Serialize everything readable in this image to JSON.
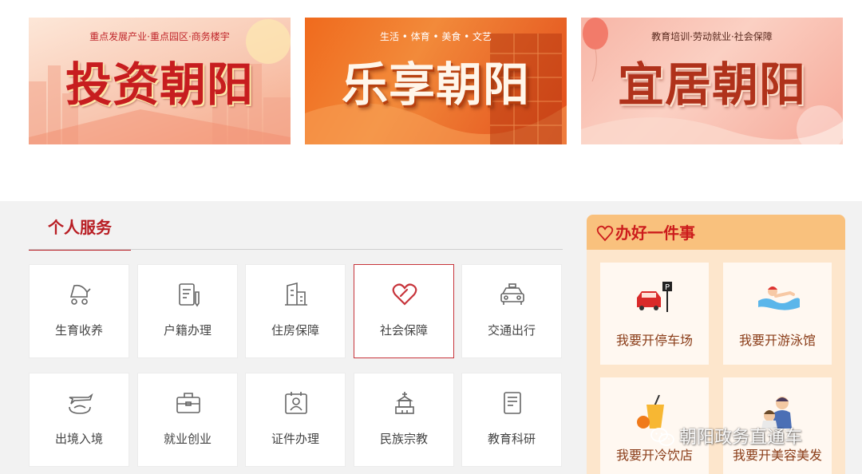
{
  "banners": [
    {
      "subtitle": "重点发展产业·重点园区·商务楼宇",
      "title": "投资朝阳"
    },
    {
      "subtitle": "生活 • 体育 • 美食 • 文艺",
      "title": "乐享朝阳"
    },
    {
      "subtitle": "教育培训·劳动就业·社会保障",
      "title": "宜居朝阳"
    }
  ],
  "services": {
    "title": "个人服务",
    "items": [
      {
        "label": "生育收养",
        "icon": "stroller-icon"
      },
      {
        "label": "户籍办理",
        "icon": "document-pen-icon"
      },
      {
        "label": "住房保障",
        "icon": "building-icon"
      },
      {
        "label": "社会保障",
        "icon": "heart-icon",
        "active": true
      },
      {
        "label": "交通出行",
        "icon": "car-icon"
      },
      {
        "label": "出境入境",
        "icon": "airplane-globe-icon"
      },
      {
        "label": "就业创业",
        "icon": "briefcase-icon"
      },
      {
        "label": "证件办理",
        "icon": "id-card-icon"
      },
      {
        "label": "民族宗教",
        "icon": "temple-icon"
      },
      {
        "label": "教育科研",
        "icon": "book-icon"
      }
    ]
  },
  "one_thing": {
    "title": "办好一件事",
    "items": [
      {
        "label": "我要开停车场",
        "icon": "parking-car-icon"
      },
      {
        "label": "我要开游泳馆",
        "icon": "swimmer-icon"
      },
      {
        "label": "我要开冷饮店",
        "icon": "cold-drink-icon"
      },
      {
        "label": "我要开美容美发",
        "icon": "hairdresser-icon"
      }
    ]
  },
  "watermark": "朝阳政务直通车",
  "colors": {
    "accent": "#b81c22",
    "panel_bg": "#fde6cc",
    "panel_head": "#f9c17d"
  }
}
